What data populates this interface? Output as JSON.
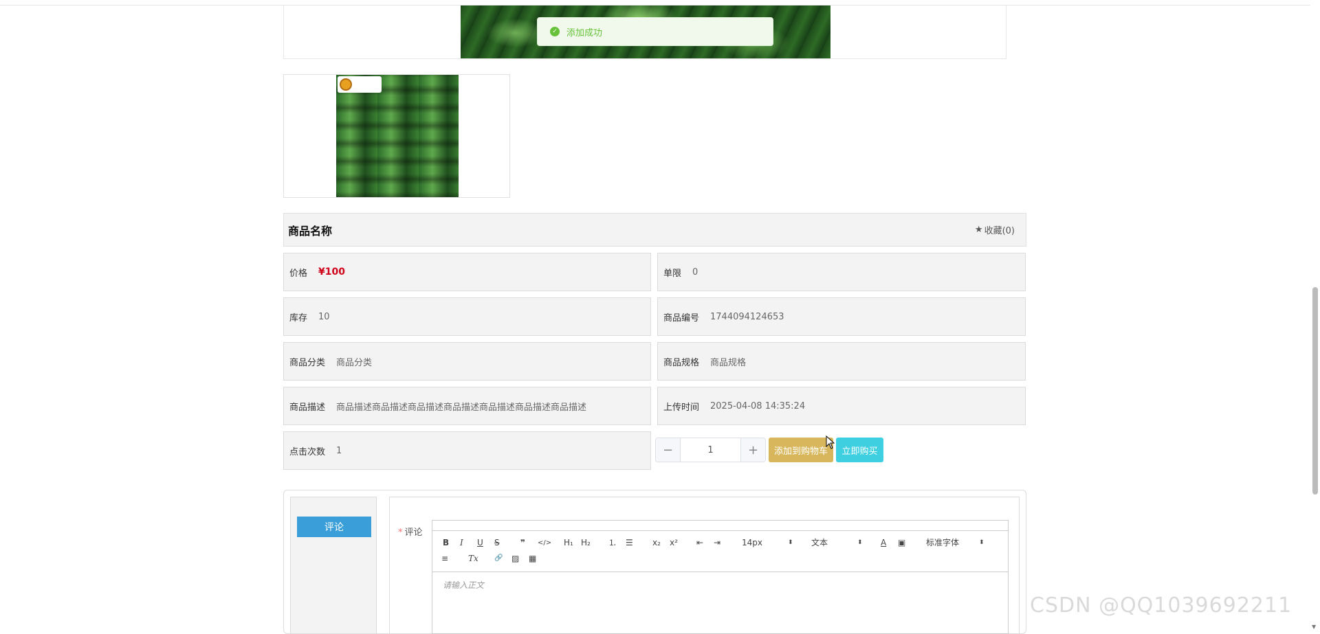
{
  "toast": {
    "text": "添加成功"
  },
  "product": {
    "name_title": "商品名称",
    "favorite": {
      "icon": "star-icon",
      "label": "收藏(0)"
    },
    "fields": {
      "price": {
        "label": "价格",
        "value": "¥100"
      },
      "limit": {
        "label": "单限",
        "value": "0"
      },
      "stock": {
        "label": "库存",
        "value": "10"
      },
      "code": {
        "label": "商品编号",
        "value": "1744094124653"
      },
      "category": {
        "label": "商品分类",
        "value": "商品分类"
      },
      "spec": {
        "label": "商品规格",
        "value": "商品规格"
      },
      "description": {
        "label": "商品描述",
        "value": "商品描述商品描述商品描述商品描述商品描述商品描述商品描述"
      },
      "upload_time": {
        "label": "上传时间",
        "value": "2025-04-08 14:35:24"
      },
      "clicks": {
        "label": "点击次数",
        "value": "1"
      }
    },
    "quantity": {
      "minus": "−",
      "value": "1",
      "plus": "+"
    },
    "actions": {
      "add_to_cart": "添加到购物车",
      "buy_now": "立即购买"
    }
  },
  "comment": {
    "tab_label": "评论",
    "field_label": "评论",
    "required_mark": "*",
    "editor": {
      "toolbar": {
        "bold": "B",
        "italic": "I",
        "underline": "U",
        "strike": "S",
        "blockquote": "❞",
        "code": "</>",
        "h1": "H₁",
        "h2": "H₂",
        "ordered_list": "⒈",
        "bullet_list": "☰",
        "subscript": "x₂",
        "superscript": "x²",
        "outdent": "⇤",
        "indent": "⇥",
        "size_select": "14px",
        "header_select": "文本",
        "font_color": "A",
        "background": "▣",
        "font_select": "标准字体",
        "align": "≡",
        "clean": "Tx",
        "link": "🔗",
        "image": "▨",
        "video": "▦"
      },
      "placeholder": "请输入正文"
    }
  },
  "watermark": "CSDN @QQ1039692211",
  "colors": {
    "price": "#d0021b",
    "cart_button": "#d8b75c",
    "buy_button": "#3ecfe0",
    "comment_tab": "#3a9fd8",
    "toast_text": "#67c23a"
  }
}
